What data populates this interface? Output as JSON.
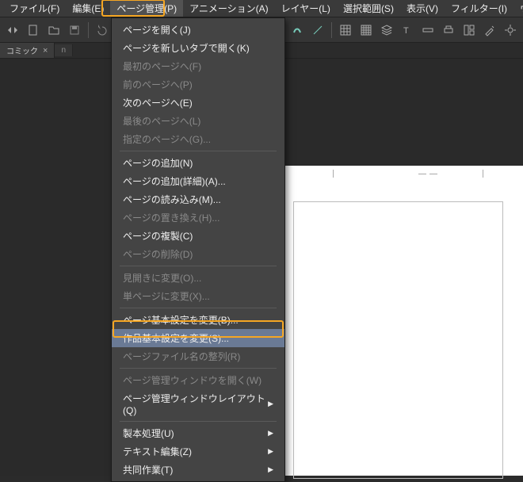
{
  "menubar": {
    "items": [
      {
        "label": "ファイル(F)"
      },
      {
        "label": "編集(E)"
      },
      {
        "label": "ページ管理(P)",
        "active": true
      },
      {
        "label": "アニメーション(A)"
      },
      {
        "label": "レイヤー(L)"
      },
      {
        "label": "選択範囲(S)"
      },
      {
        "label": "表示(V)"
      },
      {
        "label": "フィルター(I)"
      },
      {
        "label": "ウィンドウ(W)"
      }
    ]
  },
  "tab": {
    "label": "コミック",
    "close": "×",
    "second": "n"
  },
  "dropdown": {
    "groups": [
      [
        {
          "label": "ページを開く(J)",
          "en": true
        },
        {
          "label": "ページを新しいタブで開く(K)",
          "en": true
        },
        {
          "label": "最初のページへ(F)",
          "en": false
        },
        {
          "label": "前のページへ(P)",
          "en": false
        },
        {
          "label": "次のページへ(E)",
          "en": true
        },
        {
          "label": "最後のページへ(L)",
          "en": false
        },
        {
          "label": "指定のページへ(G)...",
          "en": false
        }
      ],
      [
        {
          "label": "ページの追加(N)",
          "en": true
        },
        {
          "label": "ページの追加(詳細)(A)...",
          "en": true
        },
        {
          "label": "ページの読み込み(M)...",
          "en": true
        },
        {
          "label": "ページの置き換え(H)...",
          "en": false
        },
        {
          "label": "ページの複製(C)",
          "en": true
        },
        {
          "label": "ページの削除(D)",
          "en": false
        }
      ],
      [
        {
          "label": "見開きに変更(O)...",
          "en": false
        },
        {
          "label": "単ページに変更(X)...",
          "en": false
        }
      ],
      [
        {
          "label": "ページ基本設定を変更(B)...",
          "en": true
        },
        {
          "label": "作品基本設定を変更(S)...",
          "en": true,
          "hl": true
        },
        {
          "label": "ページファイル名の整列(R)",
          "en": false
        }
      ],
      [
        {
          "label": "ページ管理ウィンドウを開く(W)",
          "en": false
        },
        {
          "label": "ページ管理ウィンドウレイアウト(Q)",
          "en": true,
          "sub": true
        }
      ],
      [
        {
          "label": "製本処理(U)",
          "en": true,
          "sub": true
        },
        {
          "label": "テキスト編集(Z)",
          "en": true,
          "sub": true
        },
        {
          "label": "共同作業(T)",
          "en": true,
          "sub": true
        }
      ]
    ]
  }
}
